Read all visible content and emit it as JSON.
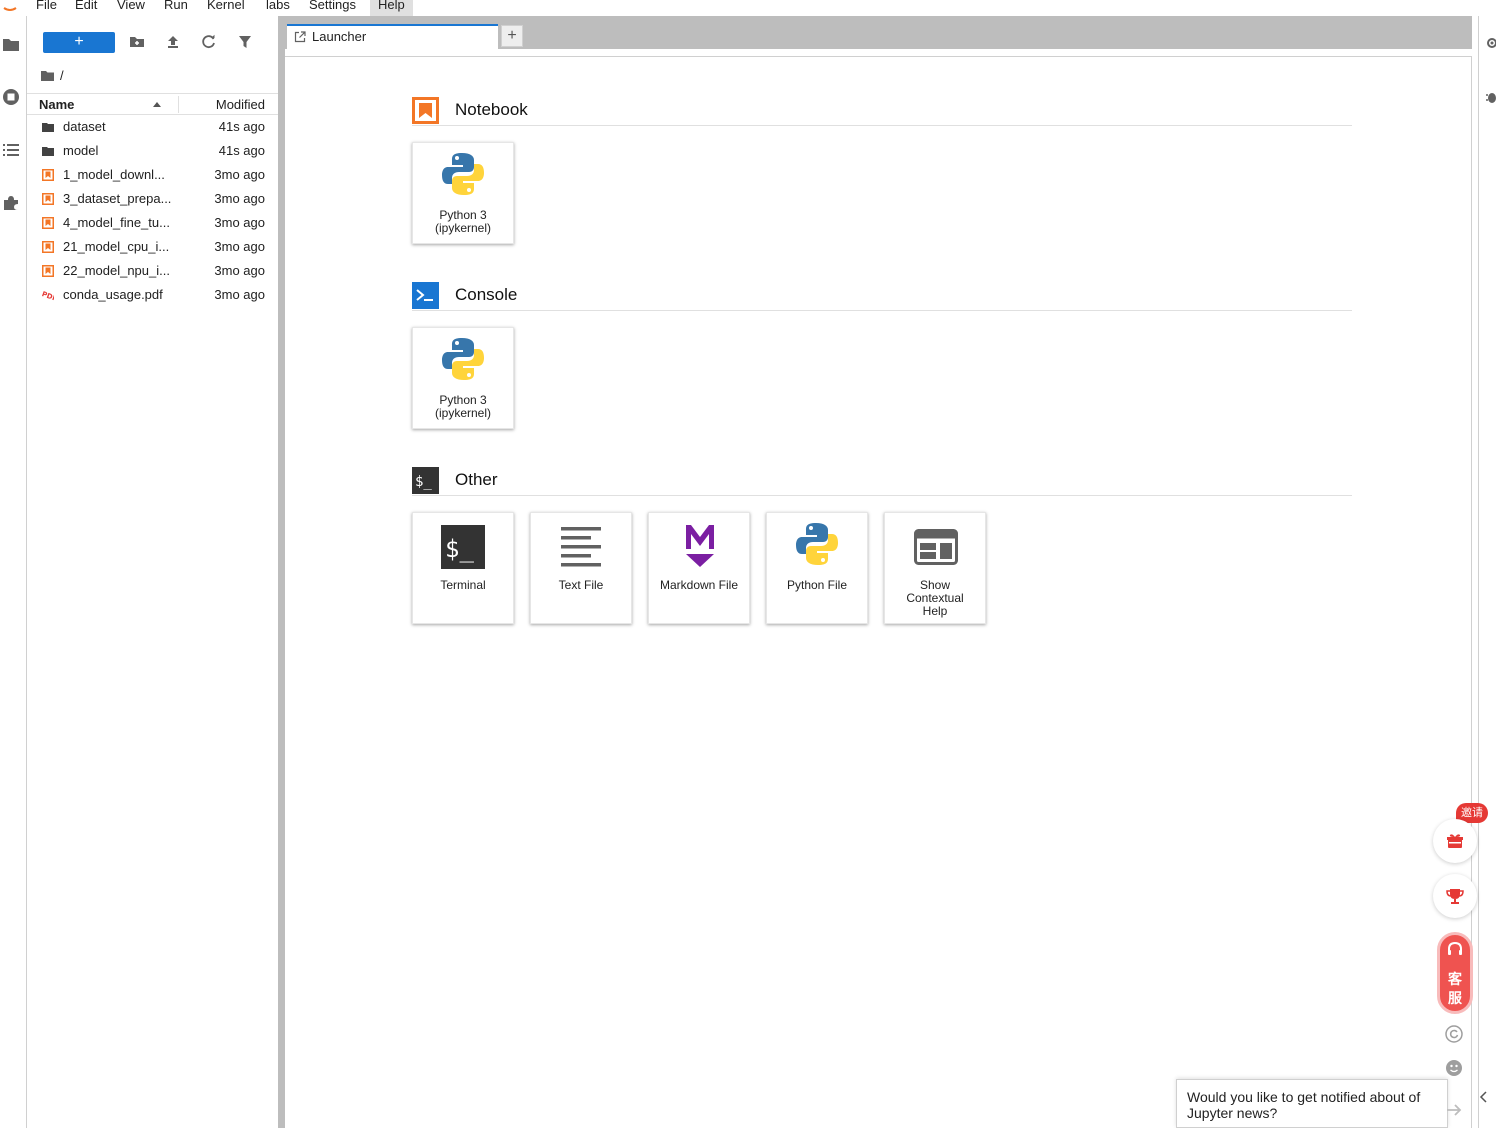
{
  "menubar": {
    "items": [
      "File",
      "Edit",
      "View",
      "Run",
      "Kernel",
      "labs",
      "Settings",
      "Help"
    ],
    "active": "Help"
  },
  "filebrowser": {
    "new_button": "+",
    "breadcrumb": "/",
    "columns": {
      "name": "Name",
      "modified": "Modified"
    },
    "files": [
      {
        "name": "dataset",
        "modified": "41s ago",
        "kind": "folder"
      },
      {
        "name": "model",
        "modified": "41s ago",
        "kind": "folder"
      },
      {
        "name": "1_model_downl...",
        "modified": "3mo ago",
        "kind": "notebook"
      },
      {
        "name": "3_dataset_prepa...",
        "modified": "3mo ago",
        "kind": "notebook"
      },
      {
        "name": "4_model_fine_tu...",
        "modified": "3mo ago",
        "kind": "notebook"
      },
      {
        "name": "21_model_cpu_i...",
        "modified": "3mo ago",
        "kind": "notebook"
      },
      {
        "name": "22_model_npu_i...",
        "modified": "3mo ago",
        "kind": "notebook"
      },
      {
        "name": "conda_usage.pdf",
        "modified": "3mo ago",
        "kind": "pdf"
      }
    ]
  },
  "tabs": {
    "launcher_label": "Launcher",
    "add_label": "+"
  },
  "launcher": {
    "notebook": {
      "title": "Notebook",
      "cards": [
        {
          "line1": "Python 3",
          "line2": "(ipykernel)",
          "icon": "python-icon"
        }
      ]
    },
    "console": {
      "title": "Console",
      "cards": [
        {
          "line1": "Python 3",
          "line2": "(ipykernel)",
          "icon": "python-icon"
        }
      ]
    },
    "other": {
      "title": "Other",
      "cards": [
        {
          "line1": "Terminal",
          "icon": "terminal-icon"
        },
        {
          "line1": "Text File",
          "icon": "text-file-icon"
        },
        {
          "line1": "Markdown File",
          "icon": "markdown-icon"
        },
        {
          "line1": "Python File",
          "icon": "python-icon"
        },
        {
          "line1": "Show",
          "line2": "Contextual",
          "line3": "Help",
          "icon": "contextual-help-icon"
        }
      ]
    }
  },
  "widgets": {
    "invite_badge": "邀请",
    "service_label_1": "客",
    "service_label_2": "服"
  },
  "toast": {
    "message_line1": "Would you like to get notified about of",
    "message_line2": "Jupyter news?"
  },
  "colors": {
    "accent": "#1976d2",
    "notebook_orange": "#f37626",
    "console_blue": "#1976d2",
    "terminal_dark": "#333333",
    "markdown_purple": "#7b1fa2",
    "service_red": "#ef5350"
  }
}
